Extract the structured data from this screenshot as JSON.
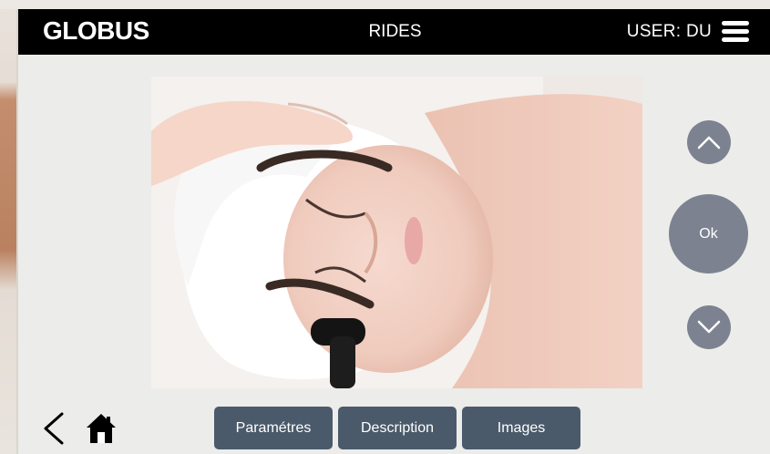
{
  "header": {
    "logo": "GLOBUS",
    "title": "RIDES",
    "user_label": "USER: DU",
    "menu_icon": "hamburger-menu-icon"
  },
  "main": {
    "image_icon": "facial-treatment-photo"
  },
  "controls": {
    "up_icon": "chevron-up-icon",
    "ok_label": "Ok",
    "down_icon": "chevron-down-icon"
  },
  "tabs": [
    {
      "label": "Paramétres"
    },
    {
      "label": "Description"
    },
    {
      "label": "Images"
    }
  ],
  "footer": {
    "back_icon": "back-arrow-icon",
    "home_icon": "home-icon"
  },
  "colors": {
    "header_bg": "#000000",
    "screen_bg": "#ececea",
    "round_button": "#7d8290",
    "tab_button": "#4a5a6a"
  }
}
